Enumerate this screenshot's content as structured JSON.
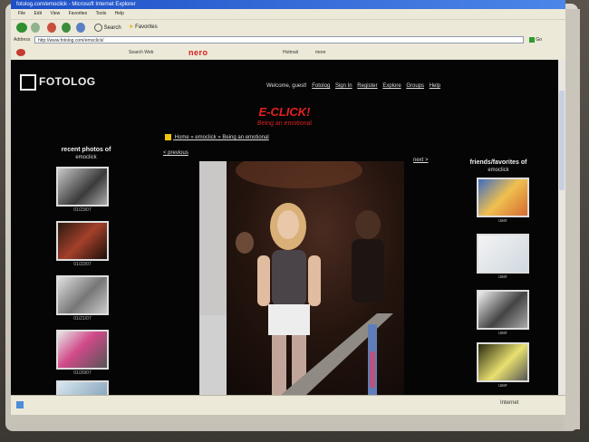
{
  "browser": {
    "title": "fotolog.com/emoclick - Microsoft Internet Explorer",
    "menu": [
      "File",
      "Edit",
      "View",
      "Favorites",
      "Tools",
      "Help"
    ],
    "toolbar": {
      "search": "Search",
      "favorites": "Favorites"
    },
    "address_label": "Address",
    "address": "http://www.fotolog.com/emoclick/",
    "go": "Go",
    "links": {
      "search_web": "Search Web",
      "nero": "nero",
      "hotmail": "Hotmail",
      "more": "more"
    },
    "status": "Internet"
  },
  "page": {
    "logo": "FOTOLOG",
    "nav": {
      "welcome": "Welcome, guest!",
      "links": [
        "Fotolog",
        "Sign In",
        "Register",
        "Explore",
        "Groups",
        "Help"
      ]
    },
    "site_title": "E-CLICK!",
    "site_subtitle": "Being an emotional",
    "breadcrumb": "Home » emoclick » Being an emotional",
    "prev": "< previous",
    "next": "next >",
    "left_col": {
      "title": "recent photos of",
      "user": "emoclick",
      "dates": [
        "01/23/07",
        "01/22/07",
        "01/21/07",
        "01/20/07",
        ""
      ]
    },
    "right_col": {
      "title": "friends/favorites of",
      "user": "emoclick",
      "names": [
        "user",
        "user",
        "user",
        "user"
      ]
    }
  },
  "colors": {
    "accent_red": "#e62020",
    "bg": "#050505",
    "ie_blue": "#1d4fc7"
  }
}
